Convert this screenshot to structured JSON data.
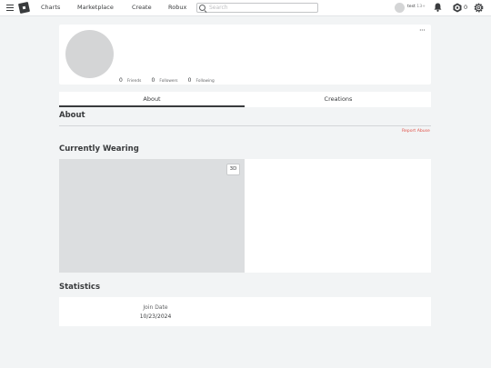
{
  "nav": {
    "links": [
      "Charts",
      "Marketplace",
      "Create",
      "Robux"
    ],
    "search_placeholder": "Search",
    "username": "test",
    "age_badge": "13+",
    "robux_count": "0"
  },
  "profile": {
    "friends_count": "0",
    "friends_label": "Friends",
    "followers_count": "0",
    "followers_label": "Followers",
    "following_count": "0",
    "following_label": "Following",
    "more_label": "···"
  },
  "tabs": [
    "About",
    "Creations"
  ],
  "about": {
    "title": "About",
    "report_abuse": "Report Abuse"
  },
  "wearing": {
    "title": "Currently Wearing",
    "btn_3d": "3D"
  },
  "statistics": {
    "title": "Statistics",
    "join_date_label": "Join Date",
    "join_date_value": "10/23/2024"
  },
  "colors": {
    "page_bg": "#f2f4f5",
    "text": "#393b3d",
    "report_abuse": "#e0524a"
  }
}
